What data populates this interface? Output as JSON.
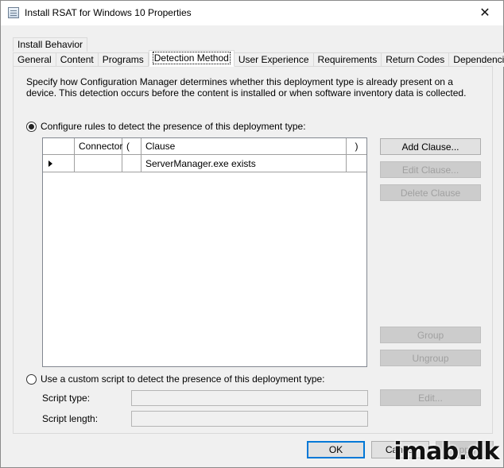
{
  "window": {
    "title": "Install RSAT for Windows 10 Properties",
    "close_glyph": "✕"
  },
  "tabs": {
    "top_row": [
      "Install Behavior"
    ],
    "bottom_row": [
      "General",
      "Content",
      "Programs",
      "Detection Method",
      "User Experience",
      "Requirements",
      "Return Codes",
      "Dependencies"
    ],
    "active": "Detection Method"
  },
  "panel": {
    "description": "Specify how Configuration Manager determines whether this deployment type is already present on a device. This detection occurs before the content is installed or when software inventory data is collected.",
    "option_rules": {
      "label": "Configure rules to detect the presence of this deployment type:",
      "checked": true
    },
    "option_script": {
      "label": "Use a custom script to detect the presence of this deployment type:",
      "checked": false
    },
    "grid": {
      "columns": [
        "",
        "Connector",
        "(",
        "Clause",
        ")"
      ],
      "rows": [
        {
          "selector": "▶",
          "connector": "",
          "open": "",
          "clause": "ServerManager.exe exists",
          "close": ""
        }
      ]
    },
    "buttons": {
      "add_clause": "Add Clause...",
      "edit_clause": "Edit Clause...",
      "delete_clause": "Delete Clause",
      "group": "Group",
      "ungroup": "Ungroup",
      "edit": "Edit..."
    },
    "script_type_label": "Script type:",
    "script_type_value": "",
    "script_length_label": "Script length:",
    "script_length_value": ""
  },
  "footer": {
    "ok": "OK",
    "cancel": "Cancel",
    "apply": "Apply"
  },
  "watermark": "imab.dk",
  "colors": {
    "accent": "#0078d7",
    "disabled_text": "#a0a0a0"
  }
}
